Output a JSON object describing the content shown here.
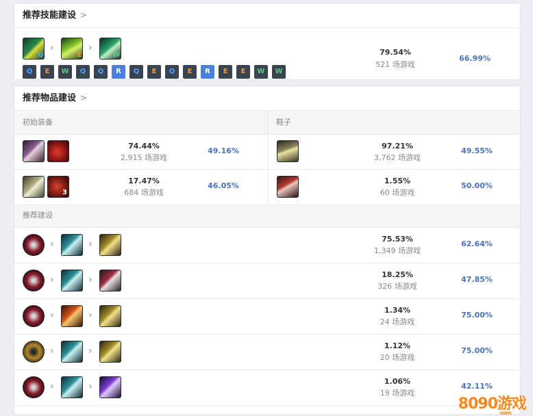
{
  "skill_build": {
    "title": "推荐技能建设",
    "chevron": ">",
    "skill_order": [
      "Q",
      "E",
      "W"
    ],
    "sequence": [
      "Q",
      "E",
      "W",
      "Q",
      "Q",
      "R",
      "Q",
      "E",
      "Q",
      "E",
      "R",
      "E",
      "E",
      "W",
      "W"
    ],
    "pick_rate": "79.54%",
    "games": "521 场游戏",
    "win_rate": "66.99%"
  },
  "item_build": {
    "title": "推荐物品建设",
    "chevron": ">",
    "starting": {
      "label": "初始装备",
      "rows": [
        {
          "icons": [
            "dagger-icon",
            "health-potion-icon"
          ],
          "count": "",
          "pick_rate": "74.44%",
          "games": "2,915 场游戏",
          "win_rate": "49.16%"
        },
        {
          "icons": [
            "long-sword-icon",
            "refillable-potion-icon"
          ],
          "count": "3",
          "pick_rate": "17.47%",
          "games": "684 场游戏",
          "win_rate": "46.05%"
        }
      ]
    },
    "boots": {
      "label": "鞋子",
      "rows": [
        {
          "icons": [
            "berserker-greaves-icon"
          ],
          "pick_rate": "97.21%",
          "games": "3,762 场游戏",
          "win_rate": "49.55%"
        },
        {
          "icons": [
            "plated-steelcaps-icon"
          ],
          "pick_rate": "1.55%",
          "games": "60 场游戏",
          "win_rate": "50.00%"
        }
      ]
    },
    "core": {
      "label": "推荐建设",
      "rows": [
        {
          "icons": [
            "blade-of-ruined-king-icon",
            "wits-end-icon",
            "guinsoos-rageblade-icon"
          ],
          "pick_rate": "75.53%",
          "games": "1,349 场游戏",
          "win_rate": "62.64%"
        },
        {
          "icons": [
            "blade-of-ruined-king-icon",
            "wits-end-icon",
            "infinity-edge-icon"
          ],
          "pick_rate": "18.25%",
          "games": "326 场游戏",
          "win_rate": "47.85%"
        },
        {
          "icons": [
            "blade-of-ruined-king-icon",
            "phantom-dancer-icon",
            "guinsoos-rageblade-icon"
          ],
          "pick_rate": "1.34%",
          "games": "24 场游戏",
          "win_rate": "75.00%"
        },
        {
          "icons": [
            "trinity-force-icon",
            "wits-end-icon",
            "guinsoos-rageblade-icon"
          ],
          "pick_rate": "1.12%",
          "games": "20 场游戏",
          "win_rate": "75.00%"
        },
        {
          "icons": [
            "blade-of-ruined-king-icon",
            "wits-end-icon",
            "nashors-tooth-icon"
          ],
          "pick_rate": "1.06%",
          "games": "19 场游戏",
          "win_rate": "42.11%"
        }
      ]
    }
  },
  "watermark": {
    "text": "8090游戏",
    "sub": "·com"
  },
  "colors": {
    "accent": "#4a73c2",
    "skill_q": "#4ea3ff",
    "skill_w": "#58c98a",
    "skill_e": "#f39a2c",
    "skill_r": "#4a7fe0"
  }
}
